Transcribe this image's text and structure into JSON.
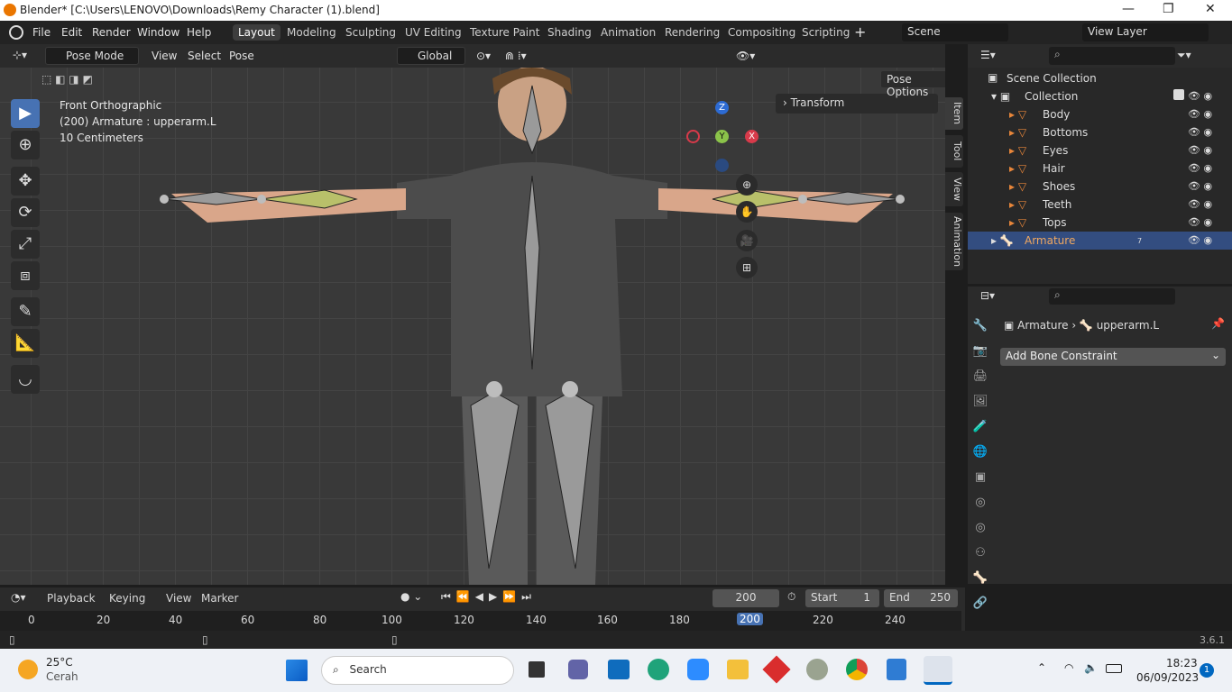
{
  "title_bar": {
    "title": "Blender* [C:\\Users\\LENOVO\\Downloads\\Remy Character (1).blend]"
  },
  "menu": [
    "File",
    "Edit",
    "Render",
    "Window",
    "Help"
  ],
  "workspaces": [
    "Layout",
    "Modeling",
    "Sculpting",
    "UV Editing",
    "Texture Paint",
    "Shading",
    "Animation",
    "Rendering",
    "Compositing",
    "Scripting"
  ],
  "scene": "Scene",
  "view_layer": "View Layer",
  "header": {
    "mode": "Pose Mode",
    "view": "View",
    "select": "Select",
    "pose": "Pose",
    "orientation": "Global",
    "pose_options": "Pose Options"
  },
  "overlay": {
    "line1": "Front Orthographic",
    "line2": "(200) Armature : upperarm.L",
    "line3": "10 Centimeters"
  },
  "transform_label": "Transform",
  "side_tabs": [
    "Item",
    "Tool",
    "View",
    "Animation"
  ],
  "gizmo": {
    "z": "Z",
    "y": "Y",
    "x": "X"
  },
  "outliner": {
    "root": "Scene Collection",
    "collection": "Collection",
    "items": [
      "Body",
      "Bottoms",
      "Eyes",
      "Hair",
      "Shoes",
      "Teeth",
      "Tops"
    ],
    "armature": "Armature",
    "armature_count": "7"
  },
  "properties": {
    "crumb_a": "Armature",
    "crumb_b": "upperarm.L",
    "add_constraint": "Add Bone Constraint"
  },
  "timeline": {
    "playback": "Playback",
    "keying": "Keying",
    "view": "View",
    "marker": "Marker",
    "current": "200",
    "start_label": "Start",
    "start": "1",
    "end_label": "End",
    "end": "250",
    "ticks": [
      "0",
      "20",
      "40",
      "60",
      "80",
      "100",
      "120",
      "140",
      "160",
      "180",
      "200",
      "220",
      "240"
    ]
  },
  "status": {
    "version": "3.6.1"
  },
  "taskbar": {
    "temp": "25°C",
    "weather": "Cerah",
    "search": "Search",
    "time": "18:23",
    "date": "06/09/2023",
    "badge": "1"
  },
  "colors": {
    "accent": "#4772b3",
    "selected_row": "#334d80",
    "bone_selected": "#b9c06a",
    "viewport_bg": "#393939"
  }
}
